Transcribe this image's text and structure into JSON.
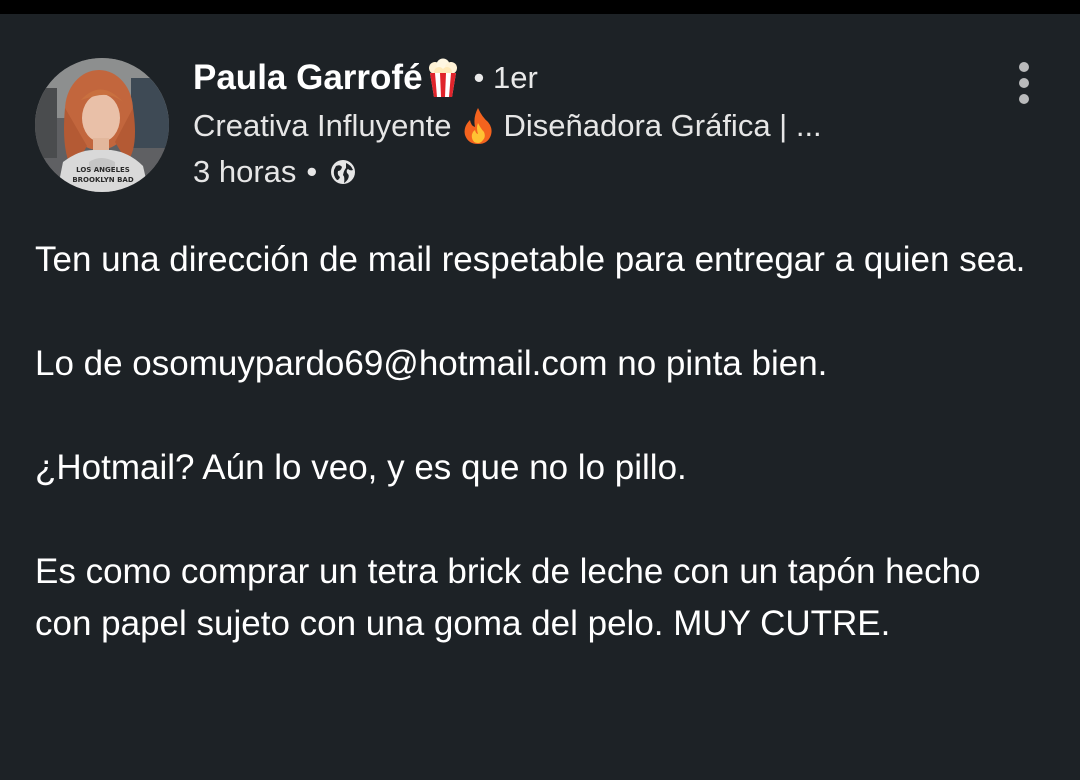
{
  "post": {
    "author": {
      "name": "Paula Garrofé",
      "name_emoji_icon": "popcorn-icon",
      "connection_degree": "• 1er",
      "headline_start": "Creativa Influyente",
      "headline_emoji_icon": "fire-icon",
      "headline_end": "Diseñadora Gráfica | ...",
      "avatar_shirt_text_line1": "LOS ANGELES",
      "avatar_shirt_text_line2": "BROOKLYN BAD"
    },
    "timestamp": "3 horas",
    "meta_separator": "•",
    "visibility_icon": "globe-icon",
    "more_options_icon": "more-vertical-icon",
    "paragraphs": [
      "Ten una dirección de mail respetable para entregar a quien sea.",
      "Lo de osomuypardo69@hotmail.com no pinta bien.",
      "¿Hotmail? Aún lo veo, y es que no lo pillo.",
      "Es como comprar un tetra brick de leche con un tapón hecho con papel sujeto con una goma del pelo. MUY CUTRE."
    ]
  },
  "colors": {
    "background": "#1d2226",
    "status_bar": "#000000",
    "text_primary": "#ffffff",
    "text_secondary": "#e6e6e6",
    "icon_gray": "#b9babb"
  }
}
